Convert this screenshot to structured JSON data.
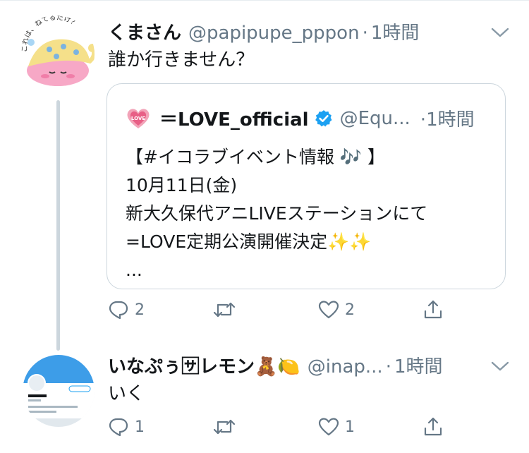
{
  "tweets": [
    {
      "name": "くまさん",
      "handle": "@papipupe_pppon",
      "dot": "·",
      "time": "1時間",
      "text": "誰か行きません？",
      "avatar_label": "これは、ねてるだけ？",
      "quote": {
        "name": "＝LOVE_official",
        "handle": "@Equ...",
        "dot": "·",
        "time": "1時間",
        "lines": [
          "【#イコラブイベント情報 🎶 】",
          "10月11日(金)",
          "新大久保代アニLIVEステーションにて",
          "=LOVE定期公演開催決定✨✨",
          "..."
        ]
      },
      "actions": {
        "reply": "2",
        "retweet": "",
        "like": "2",
        "share": ""
      }
    },
    {
      "name": "いなぷぅ🈂レモン🧸🍋",
      "handle": "@inap...",
      "dot": "·",
      "time": "1時間",
      "text": "いく",
      "actions": {
        "reply": "1",
        "retweet": "",
        "like": "1",
        "share": ""
      }
    }
  ],
  "colors": {
    "text": "#14171a",
    "secondary": "#657786",
    "border": "#ccd6dd",
    "verified": "#1da1f2",
    "avatar2_banner": "#1da1f2"
  },
  "icons": [
    "chevron-down-icon",
    "verified-icon",
    "reply-icon",
    "retweet-icon",
    "like-icon",
    "share-icon"
  ]
}
